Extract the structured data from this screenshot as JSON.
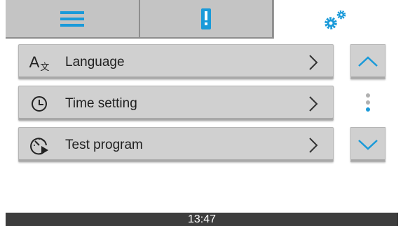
{
  "tabs": [
    {
      "id": "menu",
      "icon": "hamburger-menu-icon",
      "active": false
    },
    {
      "id": "alerts",
      "icon": "exclamation-alert-icon",
      "active": false
    },
    {
      "id": "settings",
      "icon": "gears-icon",
      "active": true
    }
  ],
  "menu": {
    "items": [
      {
        "label": "Language",
        "icon": "language-translate-icon"
      },
      {
        "label": "Time setting",
        "icon": "clock-icon"
      },
      {
        "label": "Test program",
        "icon": "test-program-gauge-icon"
      }
    ]
  },
  "scroll": {
    "up_icon": "chevron-up-icon",
    "down_icon": "chevron-down-icon"
  },
  "status_bar": {
    "time": "13:47"
  },
  "colors": {
    "accent": "#1a9ad9",
    "tab_bg": "#c4c4c4",
    "item_bg": "#d0d0d0",
    "footer_bg": "#3d3d3d"
  }
}
